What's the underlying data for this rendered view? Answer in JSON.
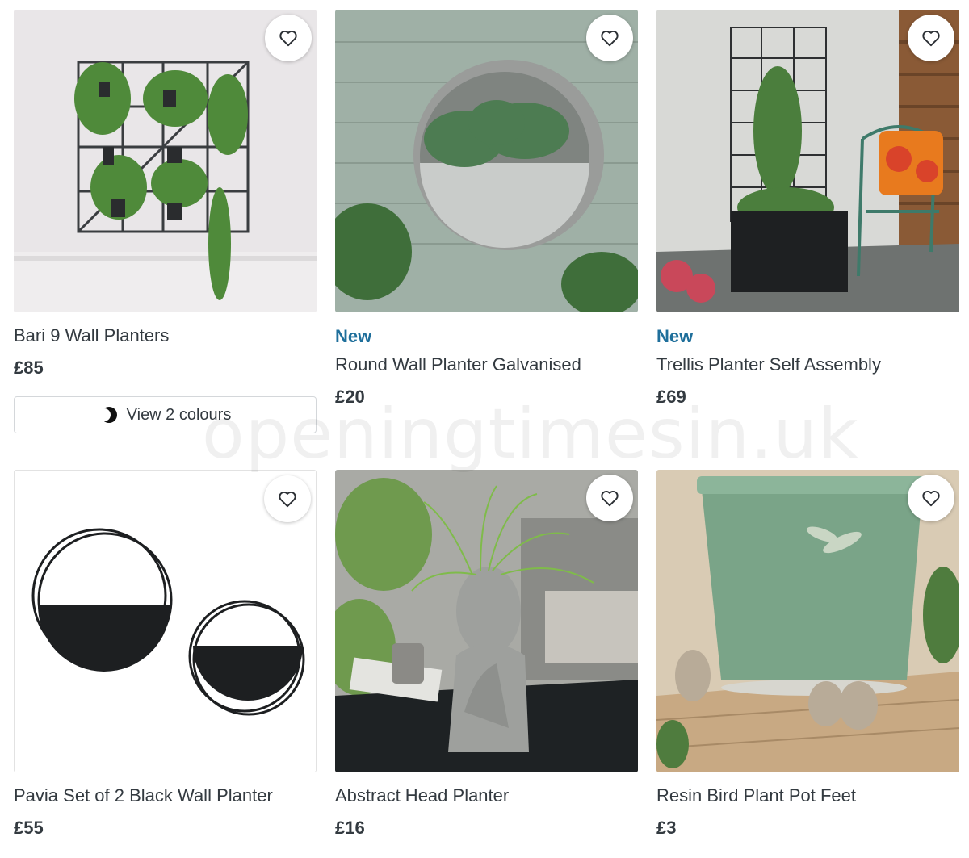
{
  "products": [
    {
      "tag": "",
      "title": "Bari 9 Wall Planters",
      "price": "£85",
      "colours_label": "View 2 colours"
    },
    {
      "tag": "New",
      "title": "Round Wall Planter Galvanised",
      "price": "£20"
    },
    {
      "tag": "New",
      "title": "Trellis Planter Self Assembly",
      "price": "£69"
    },
    {
      "tag": "",
      "title": "Pavia Set of 2 Black Wall Planter",
      "price": "£55"
    },
    {
      "tag": "",
      "title": "Abstract Head Planter",
      "price": "£16"
    },
    {
      "tag": "",
      "title": "Resin Bird Plant Pot Feet",
      "price": "£3"
    }
  ],
  "watermark": "openingtimesin.uk",
  "colors": {
    "accent": "#1f6f9b",
    "text": "#333a40",
    "border": "#d4d7da"
  },
  "icons": {
    "favourite": "heart-outline-icon",
    "colours": "colour-swatch-icon"
  }
}
